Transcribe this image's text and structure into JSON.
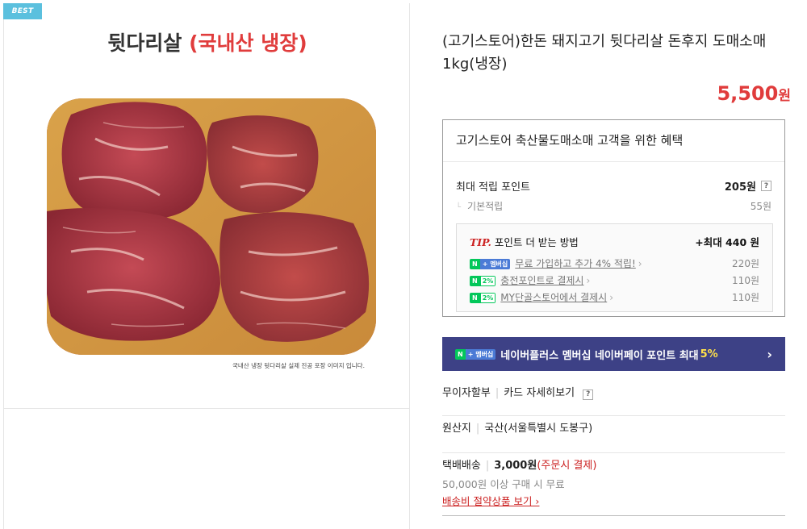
{
  "badge": "BEST",
  "image": {
    "title_main": "뒷다리살",
    "title_red": "(국내산 냉장)",
    "caption": "국내산 냉장 뒷다리살 실제 진공 포장 이미지 입니다."
  },
  "product": {
    "title": "(고기스토어)한돈 돼지고기 뒷다리살 돈후지 도매소매 1kg(냉장)",
    "price": "5,500",
    "price_unit": "원"
  },
  "benefit": {
    "heading": "고기스토어 축산물도매소매 고객을 위한 혜택",
    "max_points_label": "최대 적립 포인트",
    "max_points_value": "205원",
    "basic_label": "기본적립",
    "basic_value": "55원",
    "tip_prefix": "TIP.",
    "tip_label": "포인트 더 받는 방법",
    "tip_total": "+최대 440 원",
    "tip_rows": [
      {
        "badge_n": "N",
        "badge_extra": "+ 멤버십",
        "label": "무료 가입하고 추가 4% 적립!",
        "value": "220원"
      },
      {
        "badge_n": "N",
        "badge_extra": "2%",
        "label": "충전포인트로 결제시",
        "value": "110원"
      },
      {
        "badge_n": "N",
        "badge_extra": "2%",
        "label": "MY단골스토어에서 결제시",
        "value": "110원"
      }
    ]
  },
  "banner": {
    "badge_n": "N",
    "badge_extra": "+ 멤버십",
    "text": "네이버플러스 멤버십 네이버페이 포인트 최대",
    "highlight": "5%",
    "chevron": "›"
  },
  "info": {
    "installment_label": "무이자할부",
    "card_link": "카드 자세히보기",
    "origin_label": "원산지",
    "origin_value": "국산(서울특별시 도봉구)",
    "shipping_label": "택배배송",
    "shipping_price": "3,000원",
    "shipping_note": "(주문시 결제)",
    "free_condition": "50,000원 이상 구매 시 무료",
    "saving_link": "배송비 절약상품 보기"
  },
  "colors": {
    "price_red": "#e03c3c",
    "banner_bg": "#3d4186",
    "naver_green": "#03c75a"
  }
}
